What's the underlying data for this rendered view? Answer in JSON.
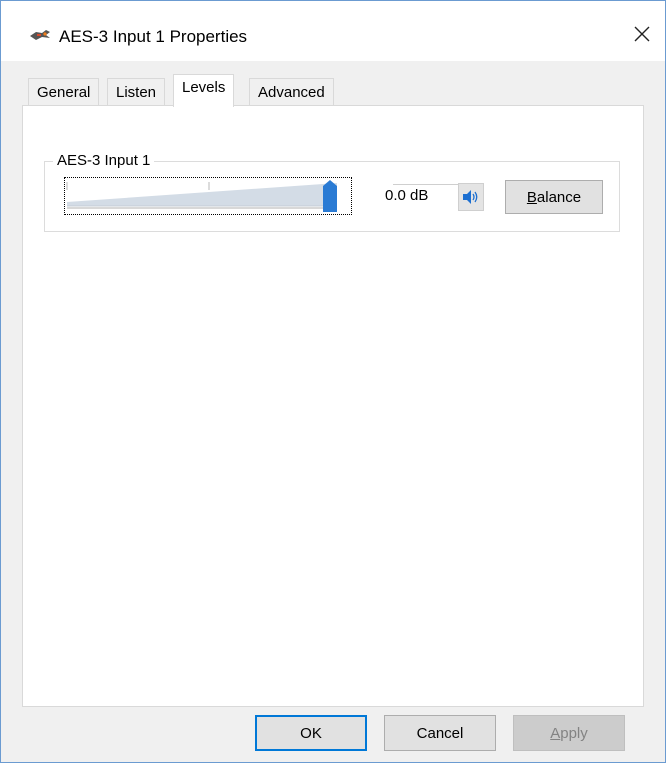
{
  "window": {
    "title": "AES-3 Input 1 Properties",
    "icon": "audio-input-icon",
    "close_icon": "close-icon"
  },
  "tabs": [
    {
      "label": "General",
      "active": false
    },
    {
      "label": "Listen",
      "active": false
    },
    {
      "label": "Levels",
      "active": true
    },
    {
      "label": "Advanced",
      "active": false
    }
  ],
  "levels": {
    "group_label": "AES-3 Input 1",
    "slider_level": 1.0,
    "value_text": "0.0 dB",
    "mute_icon": "speaker-icon",
    "balance_label_first": "B",
    "balance_label_rest": "alance"
  },
  "buttons": {
    "ok": "OK",
    "cancel": "Cancel",
    "apply_first": "A",
    "apply_rest": "pply"
  },
  "colors": {
    "accent": "#0078d7",
    "slider_thumb": "#2a7bd4",
    "slider_track_fill": "#d3dce6"
  }
}
